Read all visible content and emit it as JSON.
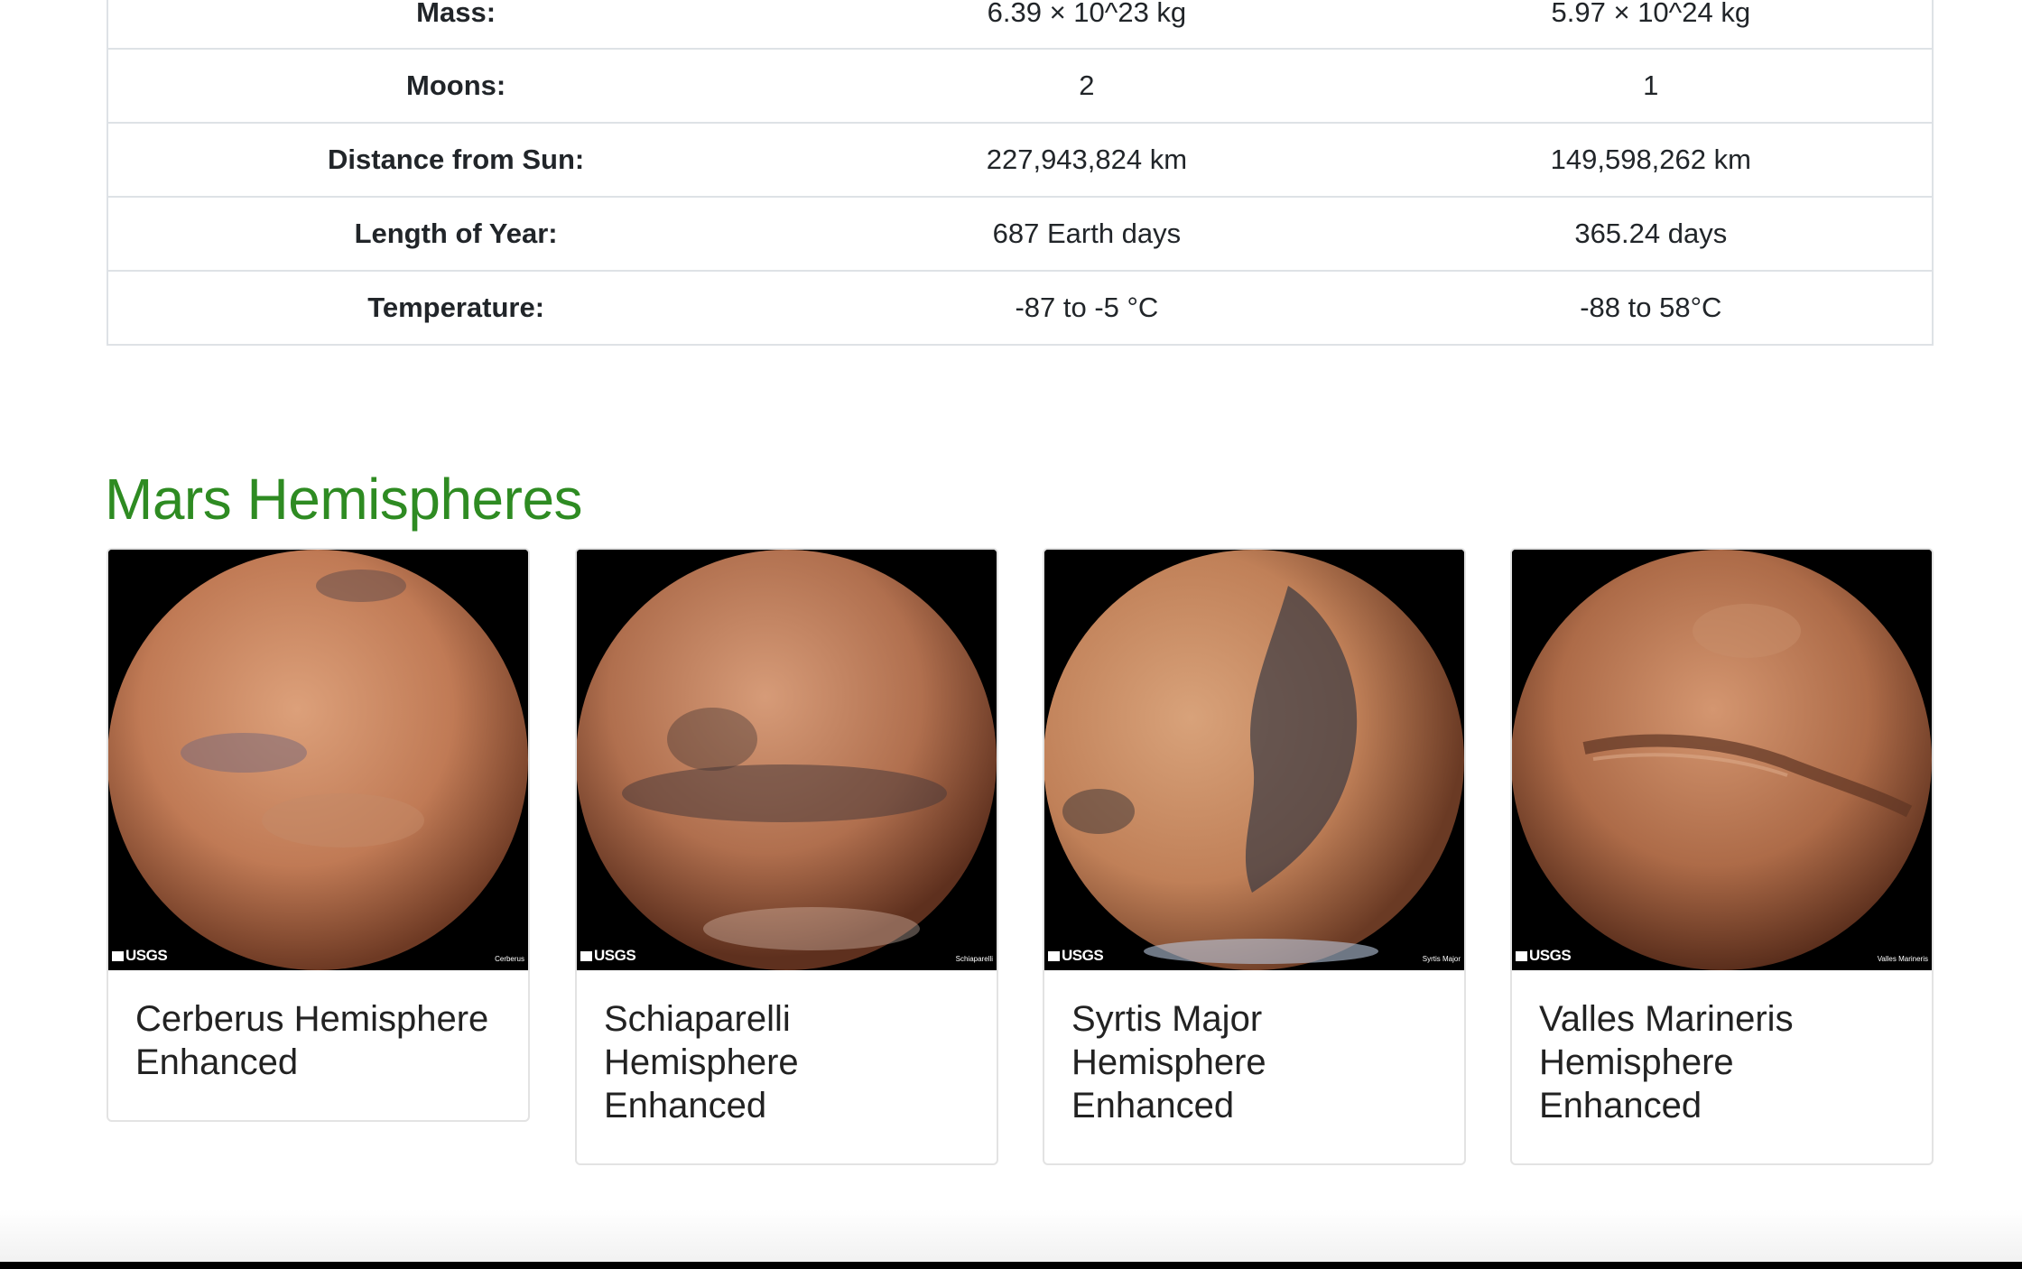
{
  "facts": [
    {
      "label": "Mass:",
      "mars": "6.39 × 10^23 kg",
      "earth": "5.97 × 10^24 kg"
    },
    {
      "label": "Moons:",
      "mars": "2",
      "earth": "1"
    },
    {
      "label": "Distance from Sun:",
      "mars": "227,943,824 km",
      "earth": "149,598,262 km"
    },
    {
      "label": "Length of Year:",
      "mars": "687 Earth days",
      "earth": "365.24 days"
    },
    {
      "label": "Temperature:",
      "mars": "-87 to -5 °C",
      "earth": "-88 to 58°C"
    }
  ],
  "hemispheres": {
    "title": "Mars Hemispheres",
    "items": [
      {
        "title": "Cerberus Hemisphere Enhanced",
        "logo": "USGS",
        "credit": "Cerberus"
      },
      {
        "title": "Schiaparelli Hemisphere Enhanced",
        "logo": "USGS",
        "credit": "Schiaparelli"
      },
      {
        "title": "Syrtis Major Hemisphere Enhanced",
        "logo": "USGS",
        "credit": "Syrtis Major"
      },
      {
        "title": "Valles Marineris Hemisphere Enhanced",
        "logo": "USGS",
        "credit": "Valles Marineris"
      }
    ]
  },
  "colors": {
    "heading": "#2e8b22",
    "planet_light": "#d99a72",
    "planet_dark": "#8a4a30"
  }
}
